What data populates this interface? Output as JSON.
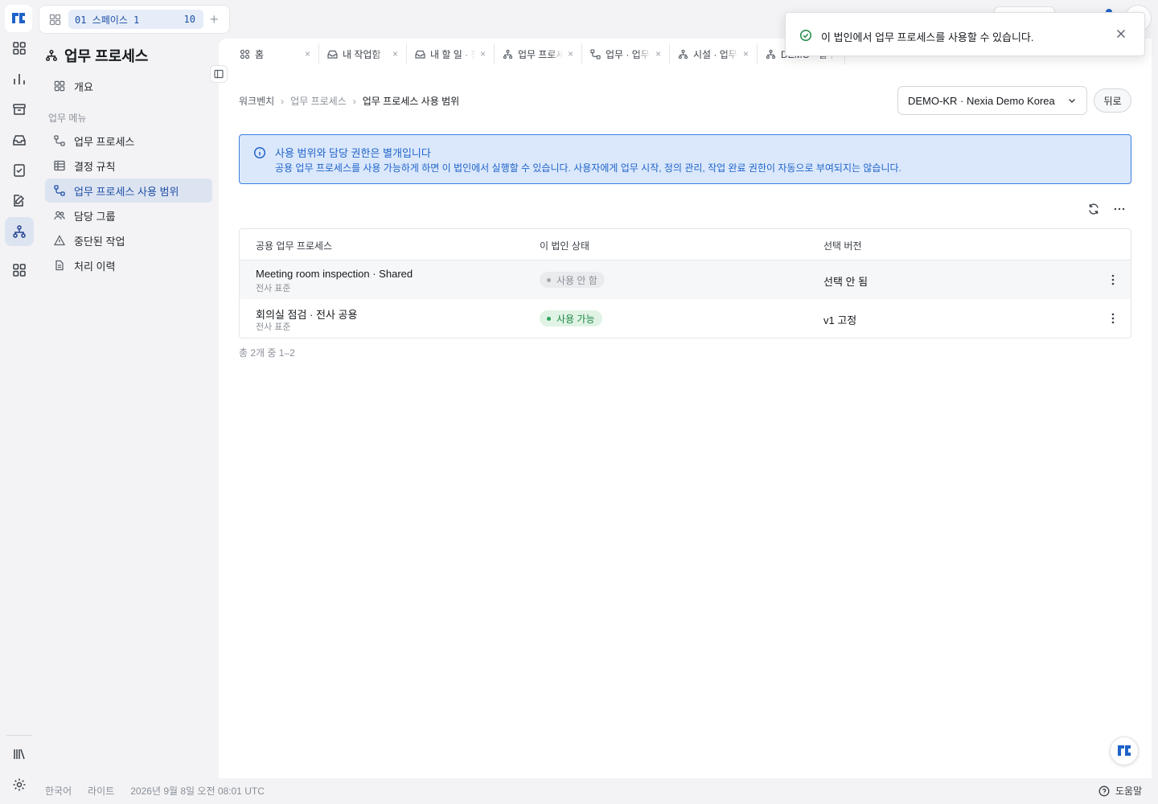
{
  "workspace": {
    "label": "01 스페이스 1",
    "count": "10"
  },
  "sidebar": {
    "title": "업무 프로세스",
    "overview": "개요",
    "section": "업무 메뉴",
    "items": [
      {
        "label": "업무 프로세스",
        "icon": "workflow-icon"
      },
      {
        "label": "결정 규칙",
        "icon": "table-icon"
      },
      {
        "label": "업무 프로세스 사용 범위",
        "icon": "workflow-icon",
        "active": true
      },
      {
        "label": "담당 그룹",
        "icon": "users-icon"
      },
      {
        "label": "중단된 작업",
        "icon": "warning-icon"
      },
      {
        "label": "처리 이력",
        "icon": "document-icon"
      }
    ]
  },
  "tabs": [
    {
      "label": "홈",
      "icon": "home-icon"
    },
    {
      "label": "내 작업함",
      "icon": "inbox-icon"
    },
    {
      "label": "내 할 일 · 전자결재",
      "icon": "inbox-icon"
    },
    {
      "label": "업무 프로세스",
      "icon": "hierarchy-icon"
    },
    {
      "label": "업무 · 업무 프로세스",
      "icon": "workflow-icon"
    },
    {
      "label": "시설 · 업무 프로세스",
      "icon": "hierarchy-icon"
    },
    {
      "label": "DEMO · 업무",
      "icon": "hierarchy-icon"
    }
  ],
  "breadcrumb": {
    "root": "워크벤치",
    "mid": "업무 프로세스",
    "current": "업무 프로세스 사용 범위"
  },
  "entity_select": {
    "value": "DEMO-KR · Nexia Demo Korea"
  },
  "back_label": "뒤로",
  "info": {
    "title": "사용 범위와 담당 권한은 별개입니다",
    "desc": "공용 업무 프로세스를 사용 가능하게 하면 이 법인에서 실행할 수 있습니다. 사용자에게 업무 시작, 정의 관리, 작업 완료 권한이 자동으로 부여되지는 않습니다."
  },
  "table": {
    "headers": [
      "공용 업무 프로세스",
      "이 법인 상태",
      "선택 버전"
    ],
    "rows": [
      {
        "name": "Meeting room inspection · Shared",
        "sub": "전사 표준",
        "status": "사용 안 함",
        "status_type": "off",
        "version": "선택 안 됨"
      },
      {
        "name": "회의실 점검 · 전사 공용",
        "sub": "전사 표준",
        "status": "사용 가능",
        "status_type": "on",
        "version": "v1 고정"
      }
    ]
  },
  "pager": "총 2개 중 1–2",
  "toast": {
    "message": "이 법인에서 업무 프로세스를 사용할 수 있습니다."
  },
  "footer": {
    "language": "한국어",
    "theme": "라이트",
    "datetime": "2026년 9월 8일 오전 08:01 UTC"
  },
  "help_label": "도움말",
  "colors": {
    "accent": "#1f63c9",
    "active_bg": "#dde4f1",
    "success": "#1f8a45",
    "info_bg": "#dbe8fb"
  }
}
